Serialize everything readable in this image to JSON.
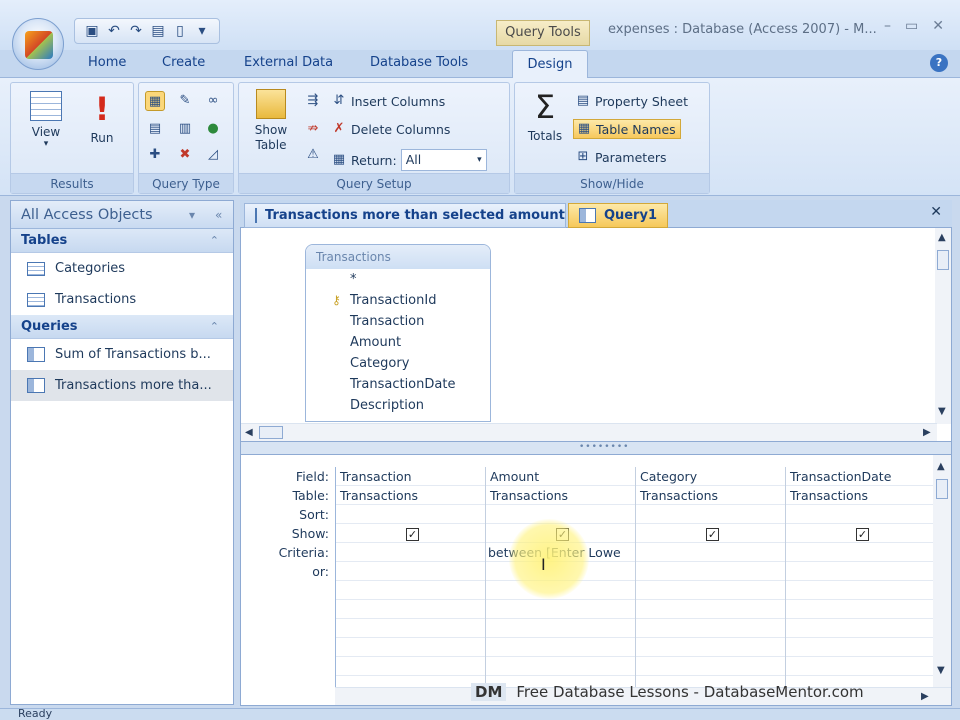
{
  "window": {
    "contextual_tab": "Query Tools",
    "title": "expenses : Database (Access 2007) - M...",
    "controls": [
      "–",
      "▭",
      "✕"
    ]
  },
  "tabs": [
    "Home",
    "Create",
    "External Data",
    "Database Tools",
    "Design"
  ],
  "ribbon": {
    "results": {
      "label": "Results",
      "view": "View",
      "run": "Run"
    },
    "query_type": {
      "label": "Query Type"
    },
    "query_setup": {
      "label": "Query Setup",
      "show_table": "Show Table",
      "insert_columns": "Insert Columns",
      "delete_columns": "Delete Columns",
      "return_label": "Return:",
      "return_value": "All"
    },
    "show_hide": {
      "label": "Show/Hide",
      "totals": "Totals",
      "property_sheet": "Property Sheet",
      "table_names": "Table Names",
      "parameters": "Parameters"
    }
  },
  "nav": {
    "header": "All Access Objects",
    "sections": [
      {
        "title": "Tables",
        "items": [
          "Categories",
          "Transactions"
        ]
      },
      {
        "title": "Queries",
        "items": [
          "Sum of Transactions b...",
          "Transactions more tha..."
        ]
      }
    ]
  },
  "doc_tabs": [
    "Transactions more than selected amount",
    "Query1"
  ],
  "field_list": {
    "title": "Transactions",
    "fields": [
      "*",
      "TransactionId",
      "Transaction",
      "Amount",
      "Category",
      "TransactionDate",
      "Description"
    ]
  },
  "grid": {
    "row_labels": [
      "Field:",
      "Table:",
      "Sort:",
      "Show:",
      "Criteria:",
      "or:"
    ],
    "columns": [
      {
        "field": "Transaction",
        "table": "Transactions",
        "criteria": ""
      },
      {
        "field": "Amount",
        "table": "Transactions",
        "criteria": "between [Enter Lowe"
      },
      {
        "field": "Category",
        "table": "Transactions",
        "criteria": ""
      },
      {
        "field": "TransactionDate",
        "table": "Transactions",
        "criteria": ""
      }
    ]
  },
  "watermark": {
    "badge": "DM",
    "text": "Free Database Lessons - DatabaseMentor.com"
  },
  "status": "Ready"
}
